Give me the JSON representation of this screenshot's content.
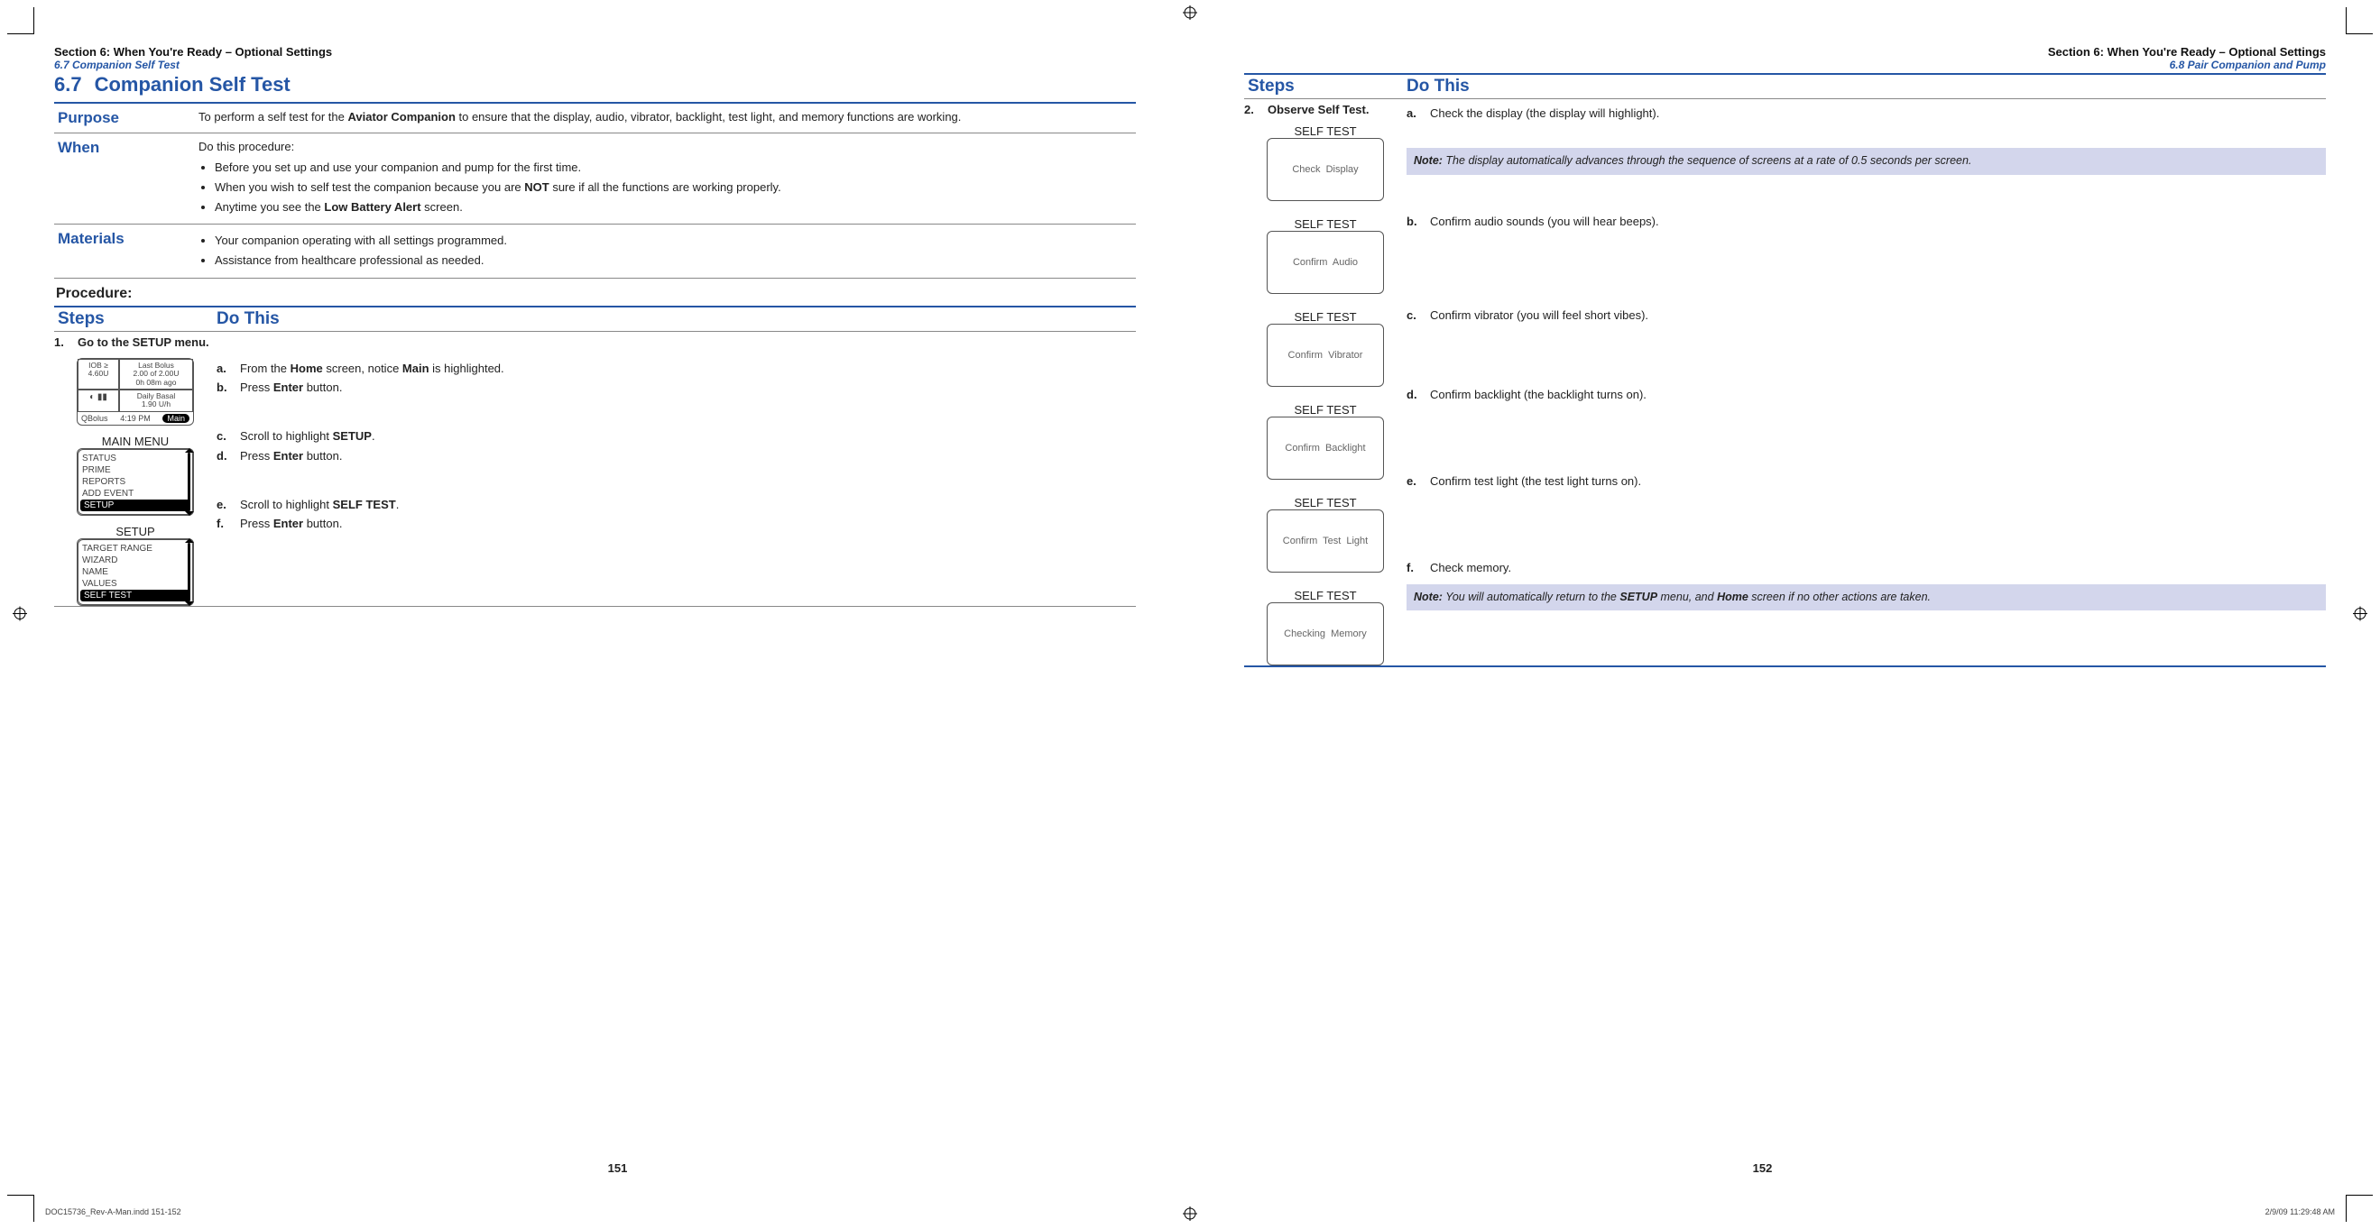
{
  "left": {
    "running_sec": "Section 6: When You're Ready – Optional Settings",
    "running_sub": "6.7 Companion Self Test",
    "title_num": "6.7",
    "title_text": "Companion Self Test",
    "purpose_label": "Purpose",
    "purpose_pre": "To perform a self test for the ",
    "purpose_bold": "Aviator Companion",
    "purpose_post": " to ensure that the display, audio, vibrator, backlight, test light, and memory functions are working.",
    "when_label": "When",
    "when_intro": "Do this procedure:",
    "when_items": {
      "a": "Before you set up and use your companion and pump for the first time.",
      "b_pre": "When you wish to self test the companion because you are ",
      "b_bold": "NOT",
      "b_post": " sure if all the functions are working properly.",
      "c_pre": "Anytime you see the ",
      "c_bold": "Low Battery Alert",
      "c_post": " screen."
    },
    "materials_label": "Materials",
    "materials_items": {
      "a": "Your companion operating with all settings programmed.",
      "b": "Assistance from healthcare professional as needed."
    },
    "procedure_label": "Procedure:",
    "steps_h1": "Steps",
    "steps_h2": "Do This",
    "step1_num": "1.",
    "step1_title": "Go to the SETUP menu.",
    "actions": {
      "a": {
        "l": "a.",
        "pre": "From the ",
        "b1": "Home",
        "mid": " screen, notice ",
        "b2": "Main",
        "post": " is highlighted."
      },
      "b": {
        "l": "b.",
        "pre": "Press ",
        "b1": "Enter",
        "post": " button."
      },
      "c": {
        "l": "c.",
        "pre": "Scroll to highlight ",
        "b1": "SETUP",
        "post": "."
      },
      "d": {
        "l": "d.",
        "pre": "Press ",
        "b1": "Enter",
        "post": " button."
      },
      "e": {
        "l": "e.",
        "pre": "Scroll to highlight ",
        "b1": "SELF TEST",
        "post": "."
      },
      "f": {
        "l": "f.",
        "pre": "Press ",
        "b1": "Enter",
        "post": " button."
      }
    },
    "home_screen": {
      "iob_l": "IOB ≥",
      "iob_v": "4.60U",
      "lb_t": "Last Bolus",
      "lb_v": "2.00 of 2.00U",
      "lb_s": "0h 08m ago",
      "db_t": "Daily Basal",
      "db_v": "1.90 U/h",
      "qb": "QBolus",
      "time": "4:19 PM",
      "main": "Main"
    },
    "menu_main": {
      "title": "MAIN MENU",
      "r1": "STATUS",
      "r2": "PRIME",
      "r3": "REPORTS",
      "r4": "ADD EVENT",
      "r5": "SETUP"
    },
    "menu_setup": {
      "title": "SETUP",
      "r1": "TARGET RANGE",
      "r2": "WIZARD",
      "r3": "NAME",
      "r4": "VALUES",
      "r5": "SELF TEST"
    },
    "page_num": "151"
  },
  "right": {
    "running_sec": "Section 6: When You're Ready – Optional Settings",
    "running_sub": "6.8 Pair Companion and Pump",
    "steps_h1": "Steps",
    "steps_h2": "Do This",
    "step2_num": "2.",
    "step2_title": "Observe Self Test.",
    "screens": {
      "t": "SELF  TEST",
      "s1": "Check  Display",
      "s2": "Confirm  Audio",
      "s3": "Confirm  Vibrator",
      "s4": "Confirm  Backlight",
      "s5": "Confirm  Test  Light",
      "s6": "Checking  Memory"
    },
    "actions": {
      "a": {
        "l": "a.",
        "t": "Check the display (the display will highlight)."
      },
      "b": {
        "l": "b.",
        "t": "Confirm audio sounds (you will hear beeps)."
      },
      "c": {
        "l": "c.",
        "t": "Confirm vibrator (you will feel short vibes)."
      },
      "d": {
        "l": "d.",
        "t": "Confirm backlight (the backlight turns on)."
      },
      "e": {
        "l": "e.",
        "t": "Confirm test light (the test light turns on)."
      },
      "f": {
        "l": "f.",
        "t": "Check memory."
      }
    },
    "note1_b": "Note:",
    "note1_t": " The display automatically advances through the sequence of screens at a rate of 0.5 seconds per screen.",
    "note2_b": "Note:",
    "note2_t_pre": " You will automatically return to the ",
    "note2_t_b1": "SETUP",
    "note2_t_mid": " menu, and ",
    "note2_t_b2": "Home",
    "note2_t_post": " screen if no other actions are taken.",
    "page_num": "152"
  },
  "footer": {
    "left": "DOC15736_Rev-A-Man.indd   151-152",
    "right": "2/9/09   11:29:48 AM"
  }
}
